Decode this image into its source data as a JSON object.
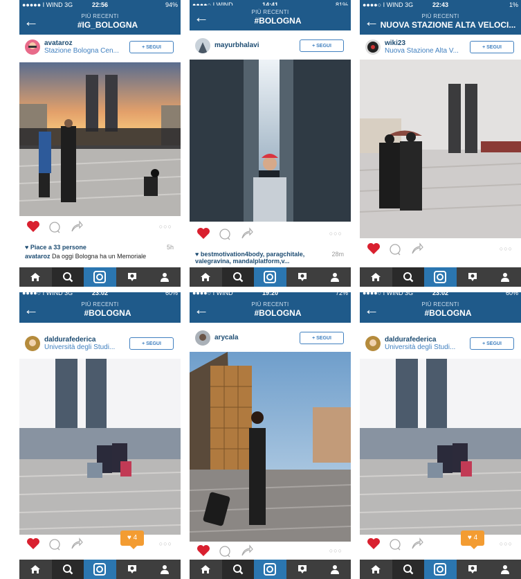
{
  "panels": [
    {
      "status": {
        "left": "●●●●● I WIND  3G",
        "time": "22:56",
        "right": "94%"
      },
      "nav": {
        "subtitle": "PIÙ RECENTI",
        "title": "#IG_BOLOGNA"
      },
      "user": {
        "name": "avataroz",
        "location": "Stazione Bologna Cen..."
      },
      "follow_label": "+ SEGUI",
      "likes": {
        "text": "Piace a 33 persone",
        "time": "5h"
      },
      "caption": {
        "user": "avataroz",
        "text": "Da oggi Bologna ha un Memoriale"
      }
    },
    {
      "status": {
        "left": "●●●●○ I WIND",
        "time": "14:41",
        "right": "81%"
      },
      "nav": {
        "subtitle": "PIÙ RECENTI",
        "title": "#BOLOGNA"
      },
      "user": {
        "name": "mayurbhalavi"
      },
      "follow_label": "+ SEGUI",
      "tags": {
        "text": "bestmotivation4body, paragchitale, valegravina, mandalplatform,v...",
        "time": "28m"
      }
    },
    {
      "status": {
        "left": "●●●●○ I WIND  3G",
        "time": "22:43",
        "right": "1%"
      },
      "nav": {
        "subtitle": "PIÙ RECENTI",
        "title": "NUOVA STAZIONE ALTA VELOCI..."
      },
      "user": {
        "name": "wiki23",
        "location": "Nuova Stazione Alta V..."
      },
      "follow_label": "+ SEGUI"
    },
    {
      "status": {
        "left": "●●●●○ I WIND  3G",
        "time": "23:02",
        "right": "60%"
      },
      "nav": {
        "subtitle": "PIÙ RECENTI",
        "title": "#BOLOGNA"
      },
      "user": {
        "name": "daldurafederica",
        "location": "Università degli Studi..."
      },
      "follow_label": "+ SEGUI",
      "notification_count": "4"
    },
    {
      "status": {
        "left": "●●●●○ I WIND",
        "time": "19:20",
        "right": "72%"
      },
      "nav": {
        "subtitle": "PIÙ RECENTI",
        "title": "#BOLOGNA"
      },
      "user": {
        "name": "arycala"
      },
      "follow_label": "+ SEGUI"
    },
    {
      "status": {
        "left": "●●●●○ I WIND  3G",
        "time": "23:02",
        "right": "60%"
      },
      "nav": {
        "subtitle": "PIÙ RECENTI",
        "title": "#BOLOGNA"
      },
      "user": {
        "name": "daldurafederica",
        "location": "Università degli Studi..."
      },
      "follow_label": "+ SEGUI",
      "notification_count": "4"
    }
  ],
  "icons": {
    "back": "arrow-left-icon",
    "like": "heart-icon",
    "comment": "comment-icon",
    "share": "share-icon",
    "tabs": [
      "home-icon",
      "search-icon",
      "camera-icon",
      "activity-icon",
      "profile-icon"
    ]
  },
  "colors": {
    "bar": "#1f5a8a",
    "accent": "#3f7fbf",
    "heart": "#d9202f",
    "tab_active": "#2b76b0",
    "notification": "#f39c32"
  }
}
